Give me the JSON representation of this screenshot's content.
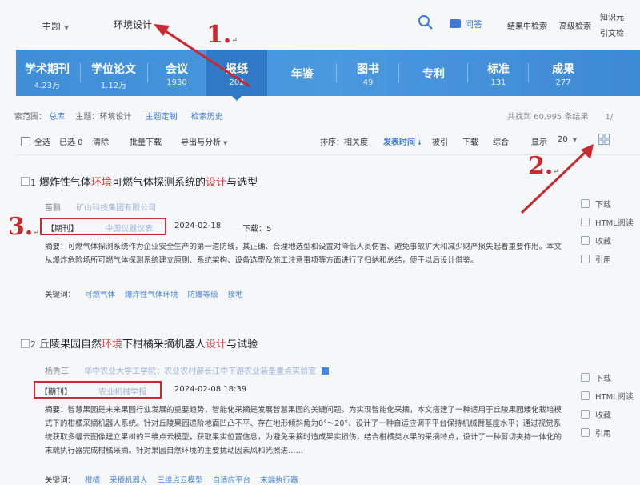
{
  "header": {
    "topic_label": "主题",
    "search_term": "环境设计",
    "ask_label": "问答",
    "links": [
      "结果中检索",
      "高级检索"
    ],
    "knowledge_line1": "知识元",
    "knowledge_line2": "引文检"
  },
  "categories": [
    {
      "name": "学术期刊",
      "count": "4.23万"
    },
    {
      "name": "学位论文",
      "count": "1.12万"
    },
    {
      "name": "会议",
      "count": "1930"
    },
    {
      "name": "报纸",
      "count": "202"
    },
    {
      "name": "年鉴",
      "count": ""
    },
    {
      "name": "图书",
      "count": "49"
    },
    {
      "name": "专利",
      "count": ""
    },
    {
      "name": "标准",
      "count": "131"
    },
    {
      "name": "成果",
      "count": "277"
    }
  ],
  "scope": {
    "range_label": "索范围：",
    "range_value": "总库",
    "topic": "主题：环境设计",
    "custom": "主题定制",
    "history": "检索历史",
    "found": "共找到 60,995 条结果",
    "page": "1/"
  },
  "toolbar": {
    "select_all": "全选",
    "selected": "已选 0",
    "clear": "清除",
    "batch_download": "批量下载",
    "export": "导出与分析",
    "sort_label": "排序：",
    "sort_options": [
      "相关度",
      "发表时间",
      "被引",
      "下载",
      "综合"
    ],
    "display_label": "显示",
    "page_size": "20"
  },
  "results": [
    {
      "index": "1",
      "title_parts": [
        {
          "text": "爆炸性气体",
          "hl": false
        },
        {
          "text": "环境",
          "hl": true
        },
        {
          "text": "可燃气体探测系统的",
          "hl": false
        },
        {
          "text": "设计",
          "hl": true
        },
        {
          "text": "与选型",
          "hl": false
        }
      ],
      "authors": "苗鹏",
      "affiliation": "矿山科技集团有限公司",
      "type_tag": "【期刊】",
      "source": "中国仪器仪表",
      "date": "2024-02-18",
      "downloads": "下载：5",
      "abstract_label": "摘要：",
      "abstract": "可燃气体探测系统作为企业安全生产的第一道防线，其正确、合理地选型和设置对降低人员伤害、避免事故扩大和减少财产损失起着重要作用。本文从爆炸危险场所可燃气体探测系统建立原则、系统架构、设备选型及施工注意事项等方面进行了归纳和总结，便于以后设计借鉴。",
      "keywords_label": "关键词：",
      "keywords": [
        "可燃气体",
        "爆炸性气体环境",
        "防爆等级",
        "接地"
      ]
    },
    {
      "index": "2",
      "title_parts": [
        {
          "text": "丘陵果园自然",
          "hl": false
        },
        {
          "text": "环境",
          "hl": true
        },
        {
          "text": "下柑橘采摘机器人",
          "hl": false
        },
        {
          "text": "设计",
          "hl": true
        },
        {
          "text": "与试验",
          "hl": false
        }
      ],
      "authors": "杨秀三",
      "affiliation": "华中农业大学工学院；农业农村部长江中下游农业装备重点实验室",
      "type_tag": "【期刊】",
      "source": "农业机械学报",
      "date": "2024-02-08 18:39",
      "downloads": "",
      "abstract_label": "摘要：",
      "abstract": "智慧果园是未来果园行业发展的重要趋势，智能化采摘是发展智慧果园的关键问题。为实现智能化采摘，本文搭建了一种适用于丘陵果园矮化栽培模式下的柑橘采摘机器人系统。针对丘陵果园递阶地面凹凸不平、存在地形倾斜角为0°～20°、设计了一种自适应调平平台保持机械臂基座水平；通过视觉系统获取多幅云图像建立果树的三维点云模型，获取果实位置信息，为避免采摘时造成果实损伤，结合柑橘类水果的采摘特点，设计了一种剪切夹持一体化的末端执行器完成柑橘采摘。针对果园自然环境的主要扰动因素风和光照进……",
      "keywords_label": "关键词：",
      "keywords": [
        "柑橘",
        "采摘机器人",
        "三维点云模型",
        "自适应平台",
        "末端执行器"
      ]
    }
  ],
  "actions": [
    "下载",
    "HTML阅读",
    "收藏",
    "引用"
  ],
  "annotations": {
    "one": "1.",
    "two": "2.",
    "three": "3.",
    "return_mark": "↵",
    "color": "#c9292f"
  },
  "colors": {
    "band": "#4a98de",
    "active_band": "#2f79c6",
    "highlight": "#e8383d",
    "link": "#4a86d8"
  }
}
